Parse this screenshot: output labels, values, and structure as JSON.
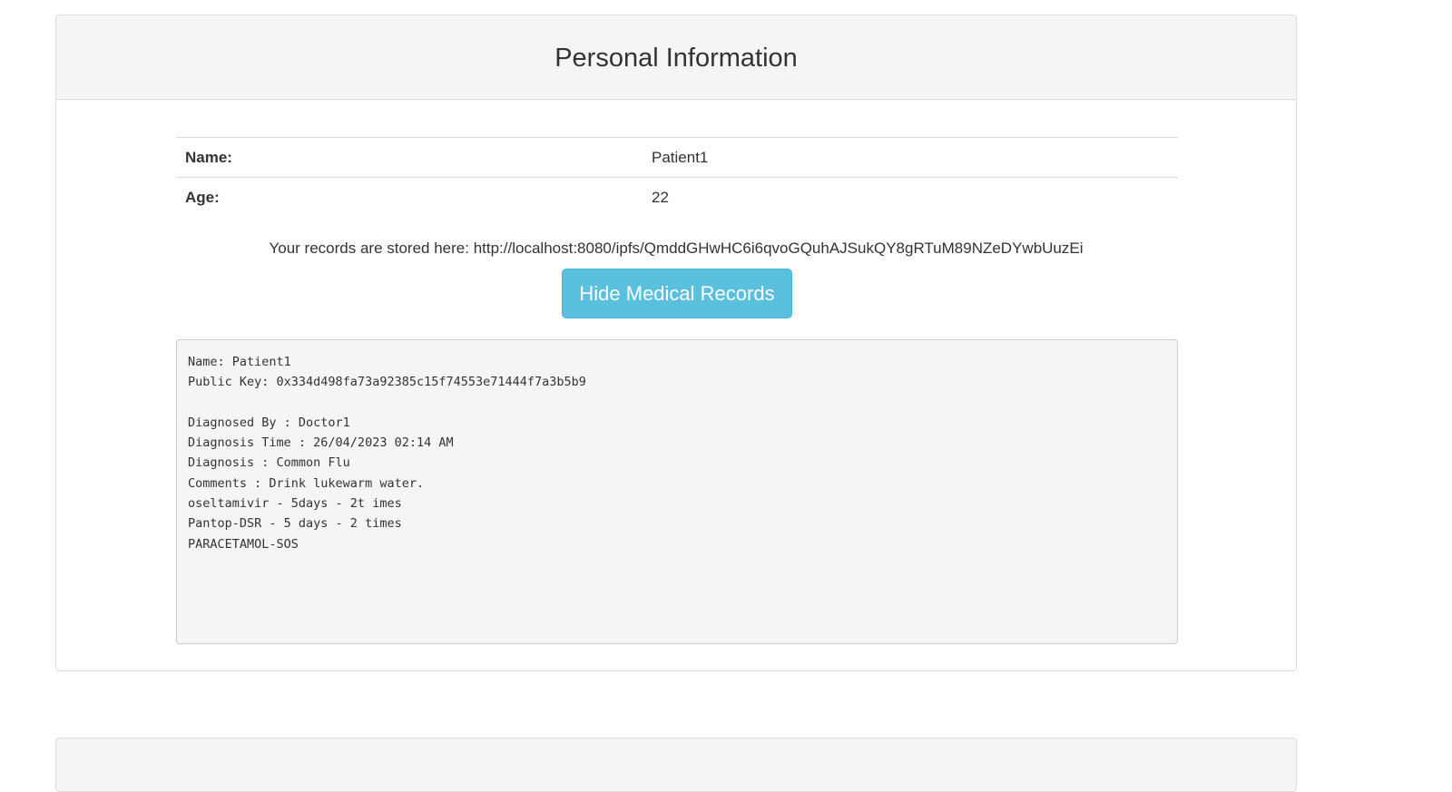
{
  "panel": {
    "title": "Personal Information"
  },
  "info_rows": [
    {
      "label": "Name:",
      "value": "Patient1"
    },
    {
      "label": "Age:",
      "value": "22"
    }
  ],
  "records_location": "Your records are stored here: http://localhost:8080/ipfs/QmddGHwHC6i6qvoGQuhAJSukQY8gRTuM89NZeDYwbUuzEi",
  "toggle_button_label": "Hide Medical Records",
  "medical_record_text": "Name: Patient1\nPublic Key: 0x334d498fa73a92385c15f74553e71444f7a3b5b9\n\nDiagnosed By : Doctor1\nDiagnosis Time : 26/04/2023 02:14 AM\nDiagnosis : Common Flu\nComments : Drink lukewarm water.\noseltamivir - 5days - 2t imes\nPantop-DSR - 5 days - 2 times\nPARACETAMOL-SOS",
  "colors": {
    "button_bg": "#5bc0de",
    "panel_heading_bg": "#f5f5f5",
    "record_box_bg": "#f5f5f5"
  }
}
